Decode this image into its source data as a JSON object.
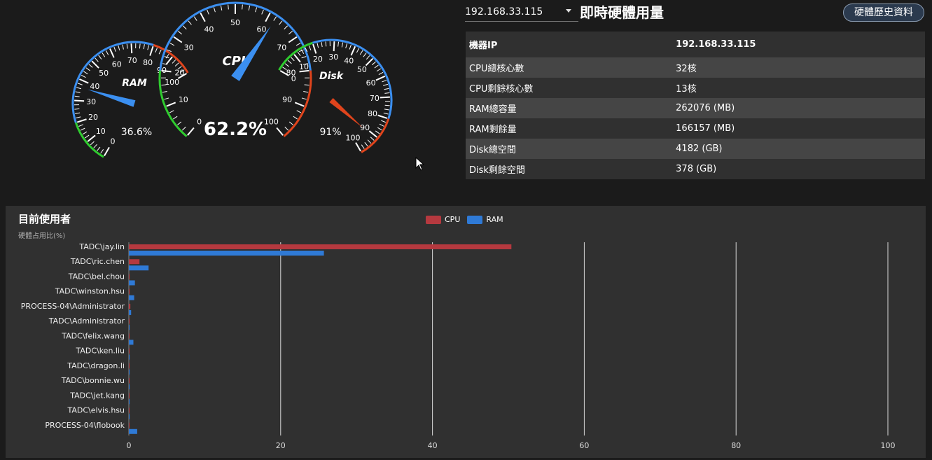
{
  "gauges": {
    "ram": {
      "label": "RAM",
      "value": 36.6,
      "display": "36.6%",
      "min": 0,
      "max": 100,
      "ticks": [
        "0",
        "10",
        "20",
        "30",
        "40",
        "50",
        "60",
        "70",
        "80",
        "90",
        "100"
      ]
    },
    "cpu": {
      "label": "CPU",
      "value": 62.2,
      "display": "62.2%",
      "min": 0,
      "max": 100,
      "ticks": [
        "0",
        "10",
        "20",
        "30",
        "40",
        "50",
        "60",
        "70",
        "80",
        "90",
        "100"
      ]
    },
    "disk": {
      "label": "Disk",
      "value": 91,
      "display": "91%",
      "min": 0,
      "max": 100,
      "ticks": [
        "0",
        "10",
        "20",
        "30",
        "40",
        "50",
        "60",
        "70",
        "80",
        "90",
        "100"
      ]
    }
  },
  "header": {
    "ip_select": "192.168.33.115",
    "title": "即時硬體用量",
    "history_button": "硬體歷史資料"
  },
  "info": [
    {
      "label": "機器IP",
      "value": "192.168.33.115"
    },
    {
      "label": "CPU總核心數",
      "value": "32核"
    },
    {
      "label": "CPU剩餘核心數",
      "value": "13核"
    },
    {
      "label": "RAM總容量",
      "value": "262076 (MB)"
    },
    {
      "label": "RAM剩餘量",
      "value": "166157 (MB)"
    },
    {
      "label": "Disk總空間",
      "value": "4182 (GB)"
    },
    {
      "label": "Disk剩餘空間",
      "value": "378 (GB)"
    }
  ],
  "users_panel": {
    "title": "目前使用者",
    "subtitle": "硬體占用比(%)"
  },
  "colors": {
    "cpu": "#b5393f",
    "ram": "#2f7ad6",
    "gauge_blue": "#3b8ff0",
    "gauge_green": "#2fcc2f",
    "gauge_red": "#e0441c"
  },
  "chart_data": {
    "type": "bar",
    "orientation": "horizontal",
    "categories": [
      "TADC\\jay.lin",
      "TADC\\ric.chen",
      "TADC\\bel.chou",
      "TADC\\winston.hsu",
      "PROCESS-04\\Administrator",
      "TADC\\Administrator",
      "TADC\\felix.wang",
      "TADC\\ken.liu",
      "TADC\\dragon.li",
      "TADC\\bonnie.wu",
      "TADC\\jet.kang",
      "TADC\\elvis.hsu",
      "PROCESS-04\\flobook"
    ],
    "series": [
      {
        "name": "CPU",
        "color": "#b5393f",
        "values": [
          50.4,
          1.4,
          0.1,
          0.1,
          0.2,
          0.1,
          0,
          0,
          0,
          0,
          0,
          0,
          0
        ]
      },
      {
        "name": "RAM",
        "color": "#2f7ad6",
        "values": [
          25.7,
          2.6,
          0.8,
          0.7,
          0.3,
          0.1,
          0.6,
          0.1,
          0.1,
          0.1,
          0.1,
          0.1,
          1.1
        ]
      }
    ],
    "xticks": [
      "0",
      "20",
      "40",
      "60",
      "80",
      "100"
    ],
    "xlim": [
      0,
      100
    ],
    "grid": true,
    "legend": "top-center"
  }
}
